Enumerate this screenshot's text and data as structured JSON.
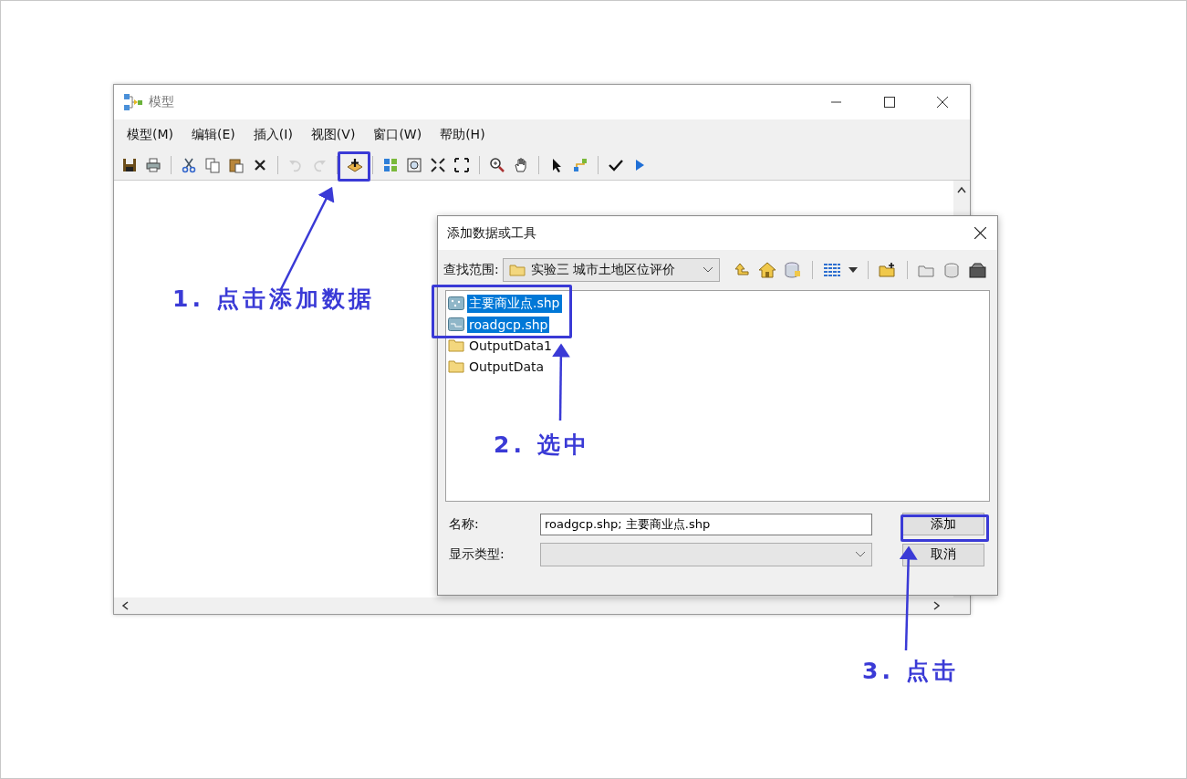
{
  "model_window": {
    "title": "模型",
    "menu": [
      "模型(M)",
      "编辑(E)",
      "插入(I)",
      "视图(V)",
      "窗口(W)",
      "帮助(H)"
    ],
    "toolbar": [
      {
        "disabled": false
      },
      {
        "disabled": false
      },
      {
        "disabled": false
      },
      {
        "disabled": false
      },
      {
        "disabled": false
      },
      {
        "disabled": false
      },
      {
        "disabled": true
      },
      {
        "disabled": true
      },
      {
        "disabled": false
      },
      {
        "disabled": false
      },
      {
        "disabled": false
      },
      {
        "disabled": false
      },
      {
        "disabled": false
      },
      {
        "disabled": false
      },
      {
        "disabled": false
      },
      {
        "disabled": false
      },
      {
        "disabled": false
      },
      {
        "disabled": false
      },
      {
        "disabled": false
      }
    ]
  },
  "dialog": {
    "title": "添加数据或工具",
    "look_in_label": "查找范围:",
    "look_in_value": "实验三 城市土地区位评价",
    "files": [
      {
        "name": "主要商业点.shp",
        "kind": "point",
        "selected": true
      },
      {
        "name": "roadgcp.shp",
        "kind": "line",
        "selected": true
      },
      {
        "name": "OutputData1",
        "kind": "folder",
        "selected": false
      },
      {
        "name": "OutputData",
        "kind": "folder",
        "selected": false
      }
    ],
    "name_label": "名称:",
    "name_value": "roadgcp.shp; 主要商业点.shp",
    "type_label": "显示类型:",
    "buttons": [
      "添加",
      "取消"
    ]
  },
  "annotations": [
    {
      "text": "1. 点击添加数据"
    },
    {
      "text": "2. 选中"
    },
    {
      "text": "3. 点击"
    }
  ]
}
